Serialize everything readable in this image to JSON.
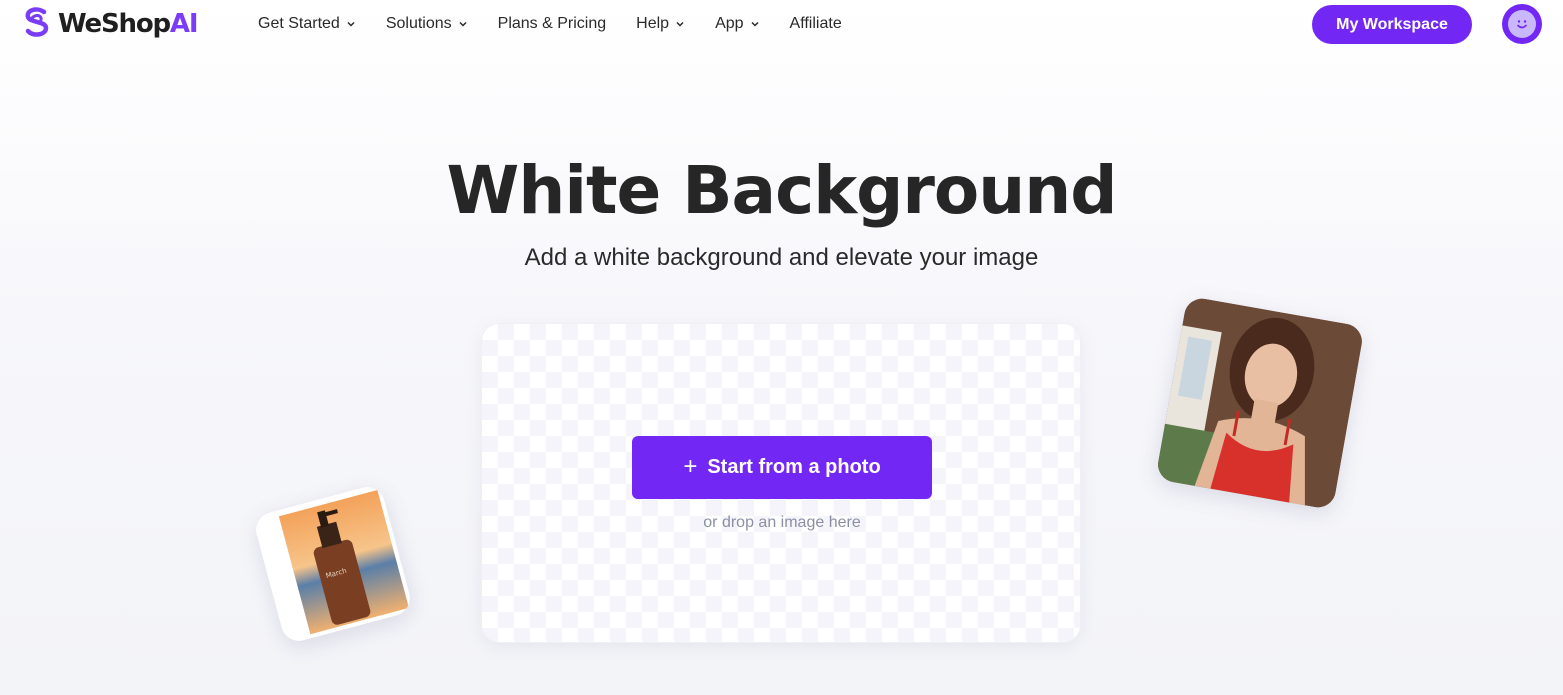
{
  "header": {
    "logo_text_main": "WeShop",
    "logo_text_accent": "AI",
    "nav": [
      {
        "label": "Get Started",
        "dropdown": true
      },
      {
        "label": "Solutions",
        "dropdown": true
      },
      {
        "label": "Plans & Pricing",
        "dropdown": false
      },
      {
        "label": "Help",
        "dropdown": true
      },
      {
        "label": "App",
        "dropdown": true
      },
      {
        "label": "Affiliate",
        "dropdown": false
      }
    ],
    "workspace_label": "My Workspace"
  },
  "hero": {
    "title": "White Background",
    "subtitle": "Add a white background and elevate your image"
  },
  "upload": {
    "button_label": "Start from a photo",
    "drop_hint": "or drop an image here"
  },
  "samples": {
    "product_label": "March"
  },
  "colors": {
    "accent": "#7327f5",
    "logo_accent": "#7a3cf5",
    "hint_text": "#8a8fa3"
  },
  "icons": {
    "logo": "weshop-s-logo-icon",
    "chevron": "chevron-down-icon",
    "plus": "plus-icon",
    "avatar": "smiley-avatar-icon"
  }
}
